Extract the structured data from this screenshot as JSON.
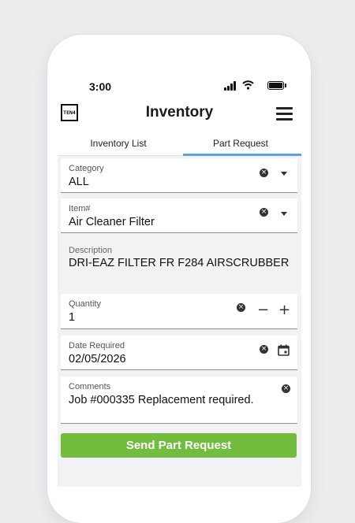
{
  "status_bar": {
    "time": "3:00"
  },
  "app": {
    "logo_text": "TEN4",
    "title": "Inventory"
  },
  "tabs": [
    {
      "label": "Inventory List",
      "active": false
    },
    {
      "label": "Part Request",
      "active": true
    }
  ],
  "form": {
    "category": {
      "label": "Category",
      "value": "ALL"
    },
    "item": {
      "label": "Item#",
      "value": "Air Cleaner Filter"
    },
    "description": {
      "label": "Description",
      "value": "DRI-EAZ FILTER FR F284 AIRSCRUBBER"
    },
    "quantity": {
      "label": "Quantity",
      "value": "1",
      "minus": "−",
      "plus": "+"
    },
    "date_required": {
      "label": "Date Required",
      "value": "02/05/2026"
    },
    "comments": {
      "label": "Comments",
      "value": "Job #000335 Replacement required."
    },
    "clear_glyph": "×"
  },
  "submit": {
    "label": "Send Part Request",
    "color": "#72bd3d"
  },
  "colors": {
    "tab_indicator": "#5aa2e0"
  }
}
